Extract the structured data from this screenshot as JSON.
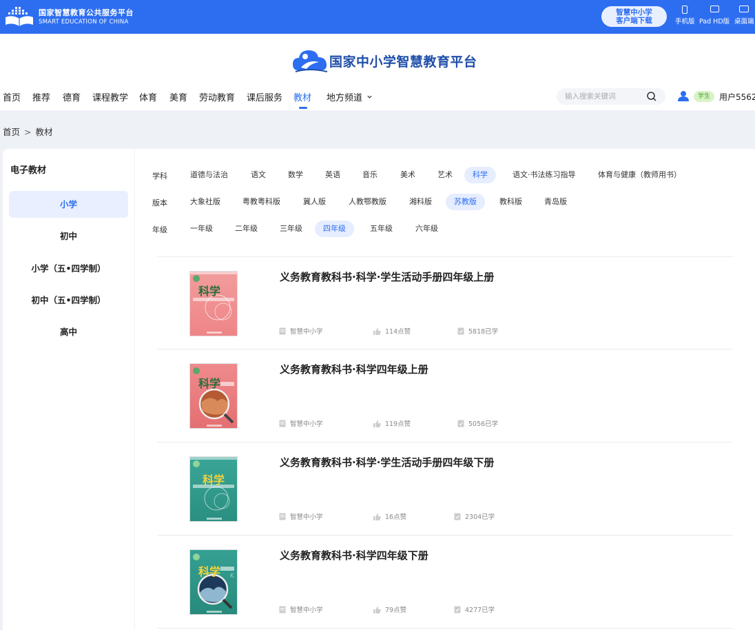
{
  "topbar": {
    "brand_cn": "国家智慧教育公共服务平台",
    "brand_en": "SMART EDUCATION OF CHINA",
    "client_line1": "智慧中小学",
    "client_line2": "客户端下载",
    "devices": [
      "手机版",
      "Pad HD版",
      "桌面端"
    ]
  },
  "header": {
    "title": "国家中小学智慧教育平台",
    "nav": [
      "首页",
      "推荐",
      "德育",
      "课程教学",
      "体育",
      "美育",
      "劳动教育",
      "课后服务",
      "教材",
      "地方频道"
    ],
    "active_nav": "教材",
    "nav_dropdown_icon": "chevron-down-icon",
    "search_placeholder": "输入搜索关键词",
    "role": "学生",
    "username": "用户5562"
  },
  "breadcrumb": {
    "home": "首页",
    "separator": ">",
    "current": "教材"
  },
  "sidebar": {
    "title": "电子教材",
    "items": [
      "小学",
      "初中",
      "小学（五•四学制）",
      "初中（五•四学制）",
      "高中"
    ],
    "active": "小学"
  },
  "filters": {
    "subject": {
      "label": "学科",
      "options": [
        "道德与法治",
        "语文",
        "数学",
        "英语",
        "音乐",
        "美术",
        "艺术",
        "科学",
        "语文·书法练习指导",
        "体育与健康（教师用书）"
      ],
      "active": "科学"
    },
    "edition": {
      "label": "版本",
      "options": [
        "大象社版",
        "粤教粤科版",
        "冀人版",
        "人教鄂教版",
        "湘科版",
        "苏教版",
        "教科版",
        "青岛版"
      ],
      "active": "苏教版"
    },
    "grade": {
      "label": "年级",
      "options": [
        "一年级",
        "二年级",
        "三年级",
        "四年级",
        "五年级",
        "六年级"
      ],
      "active": "四年级"
    }
  },
  "books": [
    {
      "title": "义务教育教科书·科学·学生活动手册四年级上册",
      "source": "智慧中小学",
      "likes": "114点赞",
      "learners": "5818已学",
      "cover_title": "科学",
      "cover_color": "#f08a8c"
    },
    {
      "title": "义务教育教科书·科学四年级上册",
      "source": "智慧中小学",
      "likes": "119点赞",
      "learners": "5056已学",
      "cover_title": "科学",
      "cover_color": "#e8787a"
    },
    {
      "title": "义务教育教科书·科学·学生活动手册四年级下册",
      "source": "智慧中小学",
      "likes": "16点赞",
      "learners": "2304已学",
      "cover_title": "科学",
      "cover_color": "#2f9b8c"
    },
    {
      "title": "义务教育教科书·科学四年级下册",
      "source": "智慧中小学",
      "likes": "79点赞",
      "learners": "4277已学",
      "cover_title": "科学",
      "cover_color": "#2e9486"
    }
  ],
  "colors": {
    "primary": "#2d6ef1",
    "active_bg": "#e6edff",
    "badge_bg": "#d9f3c8",
    "badge_text": "#4aa12a"
  }
}
